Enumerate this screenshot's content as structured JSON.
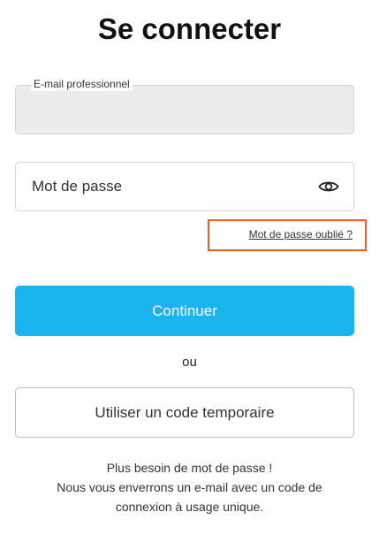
{
  "page": {
    "title": "Se connecter"
  },
  "email": {
    "label": "E-mail professionnel",
    "value": ""
  },
  "password": {
    "placeholder": "Mot de passe",
    "icon": "eye-icon"
  },
  "forgot_password": {
    "label": "Mot de passe oublié ?",
    "highlight_color": "#f05a28"
  },
  "continue_button": {
    "label": "Continuer",
    "color": "#1ab5ef"
  },
  "separator": {
    "label": "ou"
  },
  "temp_code_button": {
    "label": "Utiliser un code temporaire"
  },
  "info": {
    "line1": "Plus besoin de mot de passe !",
    "line2": "Nous vous enverrons un e-mail avec un code de",
    "line3": "connexion à usage unique."
  }
}
